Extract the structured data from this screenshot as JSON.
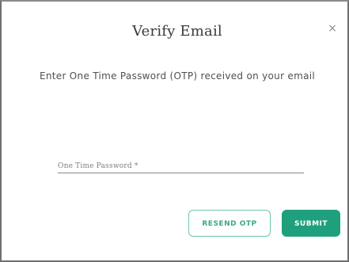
{
  "dialog": {
    "title": "Verify Email",
    "close_icon": "×",
    "message": "Enter One Time Password (OTP) received on your email",
    "otp_field": {
      "placeholder": "One Time Password *",
      "value": ""
    },
    "resend_label": "RESEND OTP",
    "submit_label": "SUBMIT"
  },
  "colors": {
    "accent": "#1fa07c",
    "accent_light": "#6cc7ad"
  }
}
